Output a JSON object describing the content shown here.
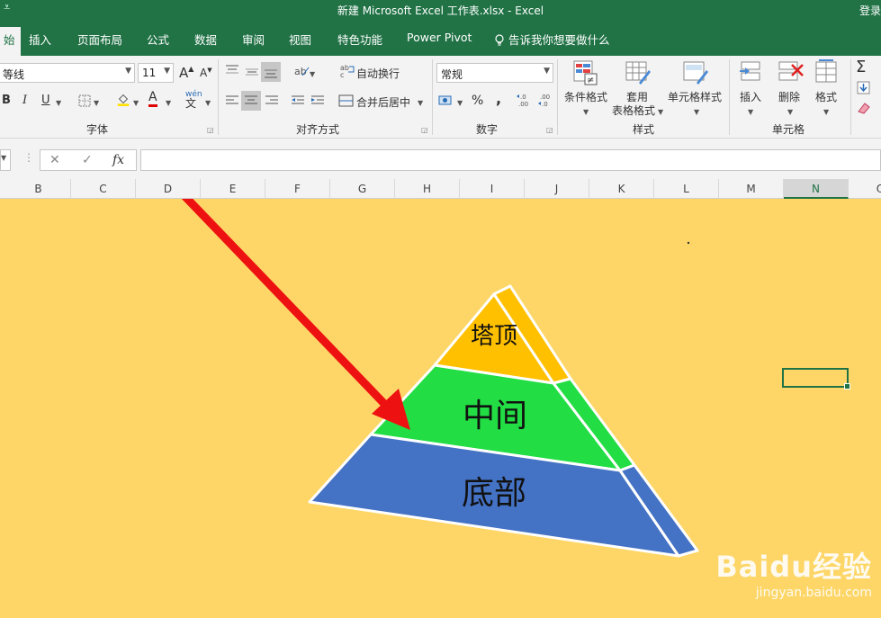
{
  "titlebar": {
    "title": "新建 Microsoft Excel 工作表.xlsx  -  Excel",
    "login": "登录"
  },
  "tabs": [
    {
      "label": "始"
    },
    {
      "label": "插入"
    },
    {
      "label": "页面布局"
    },
    {
      "label": "公式"
    },
    {
      "label": "数据"
    },
    {
      "label": "审阅"
    },
    {
      "label": "视图"
    },
    {
      "label": "特色功能"
    },
    {
      "label": "Power Pivot"
    },
    {
      "label": "告诉我你想要做什么"
    }
  ],
  "ribbon": {
    "font": {
      "name": "等线",
      "size": "11",
      "grow": "A",
      "shrink": "A",
      "bold": "B",
      "italic": "I",
      "underline": "U",
      "font_color": "A",
      "phonetic": "wén",
      "label": "字体"
    },
    "alignment": {
      "wrap_text": "自动换行",
      "merge_center": "合并后居中",
      "label": "对齐方式"
    },
    "number": {
      "format": "常规",
      "percent": "%",
      "comma": ",",
      "label": "数字"
    },
    "styles": {
      "conditional": "条件格式",
      "table_line1": "套用",
      "table_line2": "表格格式",
      "cell_styles": "单元格样式",
      "label": "样式"
    },
    "cells": {
      "insert": "插入",
      "delete": "删除",
      "format": "格式",
      "label": "单元格"
    },
    "editing": {
      "sum": "Σ"
    }
  },
  "formula_bar": {
    "cancel": "✕",
    "confirm": "✓",
    "fx": "fx",
    "value": ""
  },
  "columns": [
    "B",
    "C",
    "D",
    "E",
    "F",
    "G",
    "H",
    "I",
    "J",
    "K",
    "L",
    "M",
    "N",
    "O"
  ],
  "selected_column": "N",
  "pyramid": {
    "top_label": "塔顶",
    "middle_label": "中间",
    "bottom_label": "底部",
    "colors": {
      "top": "#ffc000",
      "middle": "#22dd44",
      "bottom": "#4472c4",
      "sheet_bg": "#fdd667",
      "arrow": "#ee1111"
    }
  },
  "watermark": {
    "brand": "Baidu经验",
    "url": "jingyan.baidu.com"
  }
}
